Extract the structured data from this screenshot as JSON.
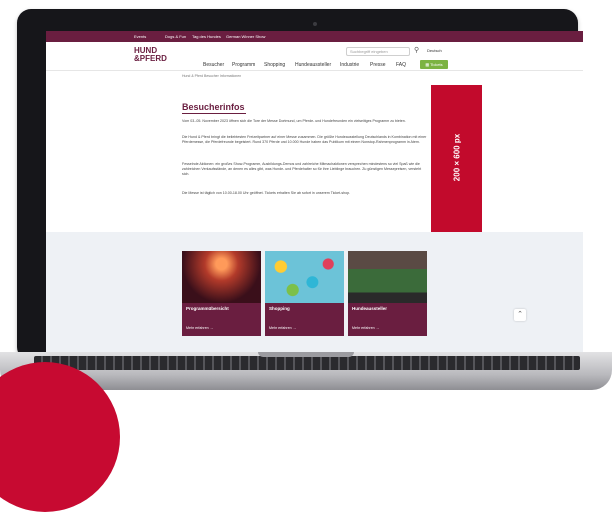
{
  "topbar": {
    "items": [
      "Events",
      "Dogs & Fun",
      "Tag des Hundes",
      "German Winner Show"
    ]
  },
  "logo": {
    "line1": "HUND",
    "line2": "&PFERD"
  },
  "header": {
    "search_placeholder": "Suchbegriff eingeben",
    "language": "Deutsch",
    "nav": [
      "Besucher",
      "Programm",
      "Shopping",
      "Hundeaussteller",
      "Industrie",
      "Presse",
      "FAQ"
    ],
    "tickets_label": "Tickets"
  },
  "breadcrumb": "Hund & Pferd  Besucher  Informationen",
  "content": {
    "title": "Besucherinfos",
    "paragraphs": [
      "Vom 03.-05. November 2023 öffnen sich die Tore der Messe Dortmund, um Pferde- und Hundefreunden ein vielseitiges Programm zu bieten.",
      "Die Hund & Pferd bringt die beliebtesten Freizeitpartner auf einer Messe zusammen. Die größte Hundeausstellung Deutschlands in Kombination mit einer Pferdemesse, die Pferdefreunde begeistert. Rund 370 Pferde und 10.000 Hunde haben das Publikum mit einem Nonstop-Rahmenprogramm in Atem.",
      "Fesselnde Aktionen: ein großes Show-Programm, Ausbildungs-Demos und zahlreiche Mitmachaktionen versprechen mindestens so viel Spaß wie die zahlreichen Verkaufsstände, an denen es alles gibt, was Hunde- und Pferdehalter so für ihre Lieblinge brauchen. Zu günstigen Messepreisen, versteht sich.",
      "Die Messe ist täglich von 10.00-18.00 Uhr geöffnet. Tickets erhalten Sie ab sofort in unserem Ticket-shop."
    ]
  },
  "ad_banner": {
    "label": "200 × 600 px"
  },
  "cards": [
    {
      "title": "Programmübersicht",
      "link": "Mehr erfahren"
    },
    {
      "title": "Shopping",
      "link": "Mehr erfahren"
    },
    {
      "title": "Hundeaussteller",
      "link": "Mehr erfahren"
    }
  ],
  "colors": {
    "brand": "#6a1e40",
    "accent_red": "#c20a2c",
    "ticket_green": "#7cb342"
  },
  "icons": {
    "search": "search-icon",
    "scroll_top": "chevron-up-icon",
    "ticket": "ticket-icon"
  }
}
